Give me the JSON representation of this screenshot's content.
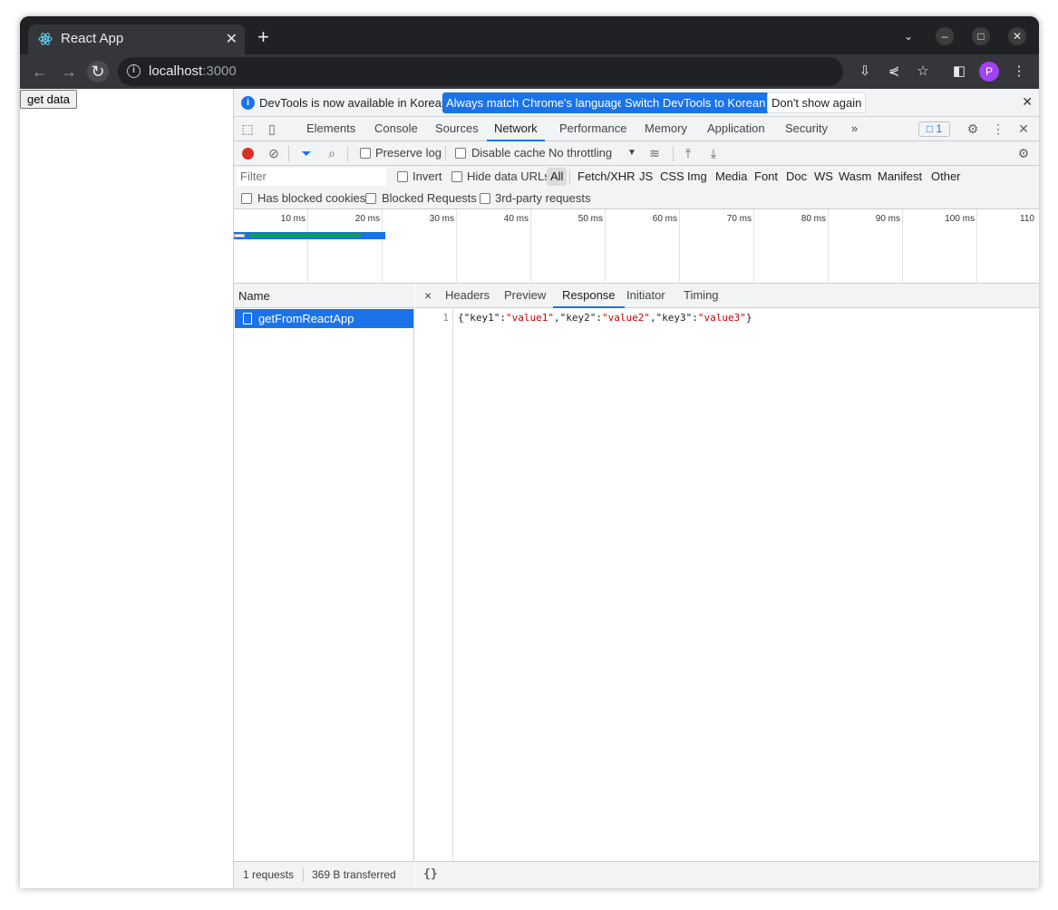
{
  "browser": {
    "tab_title": "React App",
    "tab_close": "✕",
    "new_tab": "+",
    "url_host": "localhost",
    "url_port": ":3000",
    "avatar_letter": "P"
  },
  "page": {
    "button_label": "get data"
  },
  "devtools": {
    "infobar": {
      "message": "DevTools is now available in Korean!",
      "btn_match": "Always match Chrome's language",
      "btn_switch": "Switch DevTools to Korean",
      "btn_dont_show": "Don't show again"
    },
    "tabs": [
      "Elements",
      "Console",
      "Sources",
      "Network",
      "Performance",
      "Memory",
      "Application",
      "Security"
    ],
    "more_tabs": "»",
    "issues_count": "1",
    "network_toolbar": {
      "preserve_log": "Preserve log",
      "disable_cache": "Disable cache",
      "throttling": "No throttling"
    },
    "filter": {
      "placeholder": "Filter",
      "invert": "Invert",
      "hide_data_urls": "Hide data URLs",
      "types": [
        "All",
        "Fetch/XHR",
        "JS",
        "CSS",
        "Img",
        "Media",
        "Font",
        "Doc",
        "WS",
        "Wasm",
        "Manifest",
        "Other"
      ],
      "has_blocked_cookies": "Has blocked cookies",
      "blocked_requests": "Blocked Requests",
      "third_party": "3rd-party requests"
    },
    "timeline_ticks": [
      "10 ms",
      "20 ms",
      "30 ms",
      "40 ms",
      "50 ms",
      "60 ms",
      "70 ms",
      "80 ms",
      "90 ms",
      "100 ms",
      "110"
    ],
    "requests": {
      "column_name": "Name",
      "rows": [
        "getFromReactApp"
      ],
      "summary_count": "1 requests",
      "summary_transferred": "369 B transferred"
    },
    "detail": {
      "close": "×",
      "tabs": [
        "Headers",
        "Preview",
        "Response",
        "Initiator",
        "Timing"
      ],
      "line_number": "1",
      "response_parts": [
        "{\"key1\":",
        "\"value1\"",
        ",\"key2\":",
        "\"value2\"",
        ",\"key3\":",
        "\"value3\"",
        "}"
      ],
      "pretty_print": "{}"
    }
  }
}
